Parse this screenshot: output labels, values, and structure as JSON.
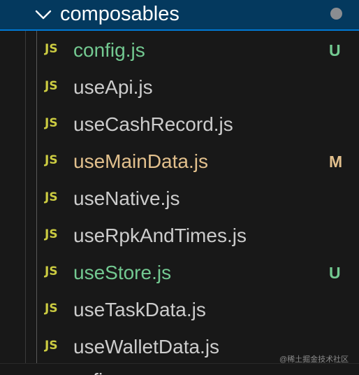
{
  "explorer": {
    "folder": {
      "name": "composables",
      "expanded_icon": "chevron-down-icon",
      "status_dot_color": "#8a8d91"
    },
    "files": [
      {
        "badge": "JS",
        "name": "config.js",
        "status": "U",
        "color": "#73c991"
      },
      {
        "badge": "JS",
        "name": "useApi.js",
        "status": "",
        "color": "#cccccc"
      },
      {
        "badge": "JS",
        "name": "useCashRecord.js",
        "status": "",
        "color": "#cccccc"
      },
      {
        "badge": "JS",
        "name": "useMainData.js",
        "status": "M",
        "color": "#e2c08d"
      },
      {
        "badge": "JS",
        "name": "useNative.js",
        "status": "",
        "color": "#cccccc"
      },
      {
        "badge": "JS",
        "name": "useRpkAndTimes.js",
        "status": "",
        "color": "#cccccc"
      },
      {
        "badge": "JS",
        "name": "useStore.js",
        "status": "U",
        "color": "#73c991"
      },
      {
        "badge": "JS",
        "name": "useTaskData.js",
        "status": "",
        "color": "#cccccc"
      },
      {
        "badge": "JS",
        "name": "useWalletData.js",
        "status": "",
        "color": "#cccccc"
      }
    ],
    "next_item_partial": "config"
  },
  "watermark": "@稀土掘金技术社区",
  "colors": {
    "selected_background": "#04395e",
    "focus_border": "#0078d4",
    "js_badge": "#cbcb41",
    "untracked": "#73c991",
    "modified": "#e2c08d"
  }
}
